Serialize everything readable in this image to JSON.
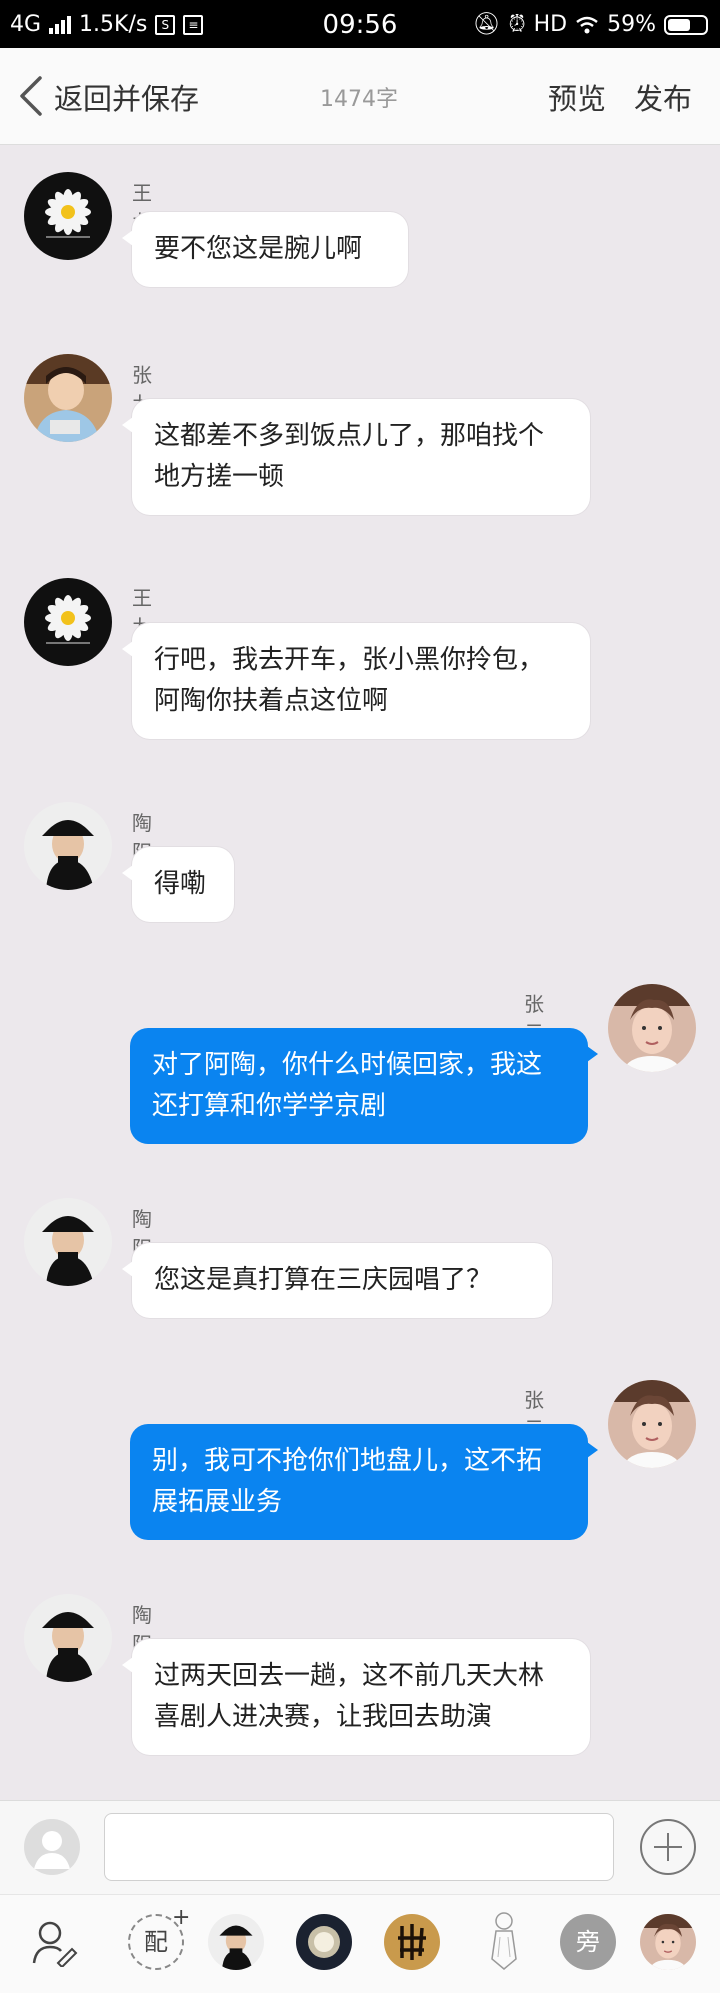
{
  "status": {
    "network": "4G",
    "speed": "1.5K/s",
    "time": "09:56",
    "hd": "HD",
    "battery": "59%"
  },
  "header": {
    "back_label": "返回并保存",
    "word_count": "1474字",
    "preview": "预览",
    "publish": "发布"
  },
  "messages": [
    {
      "side": "left",
      "name": "王九龙",
      "text": "要不您这是腕儿啊",
      "avatar": "daisy-avatar"
    },
    {
      "side": "left",
      "name": "张九龄",
      "text": "这都差不多到饭点儿了，那咱找个地方搓一顿",
      "avatar": "boy-avatar"
    },
    {
      "side": "left",
      "name": "王九龙",
      "text": "行吧，我去开车，张小黑你拎包，阿陶你扶着点这位啊",
      "avatar": "daisy-avatar"
    },
    {
      "side": "left",
      "name": "陶阳",
      "text": "得嘞",
      "avatar": "hat-avatar"
    },
    {
      "side": "right",
      "name": "张云雷",
      "text": "对了阿陶，你什么时候回家，我这还打算和你学学京剧",
      "avatar": "face-avatar"
    },
    {
      "side": "left",
      "name": "陶阳",
      "text": "您这是真打算在三庆园唱了？",
      "avatar": "hat-avatar"
    },
    {
      "side": "right",
      "name": "张云雷",
      "text": "别，我可不抢你们地盘儿，这不拓展拓展业务",
      "avatar": "face-avatar"
    },
    {
      "side": "left",
      "name": "陶阳",
      "text": "过两天回去一趟，这不前几天大林喜剧人进决赛，让我回去助演",
      "avatar": "hat-avatar"
    }
  ],
  "input": {
    "value": "",
    "placeholder": ""
  },
  "role_bar": {
    "dub_label": "配",
    "side_label": "旁"
  },
  "colors": {
    "accent": "#0a84f0",
    "background": "#ece8ec"
  }
}
